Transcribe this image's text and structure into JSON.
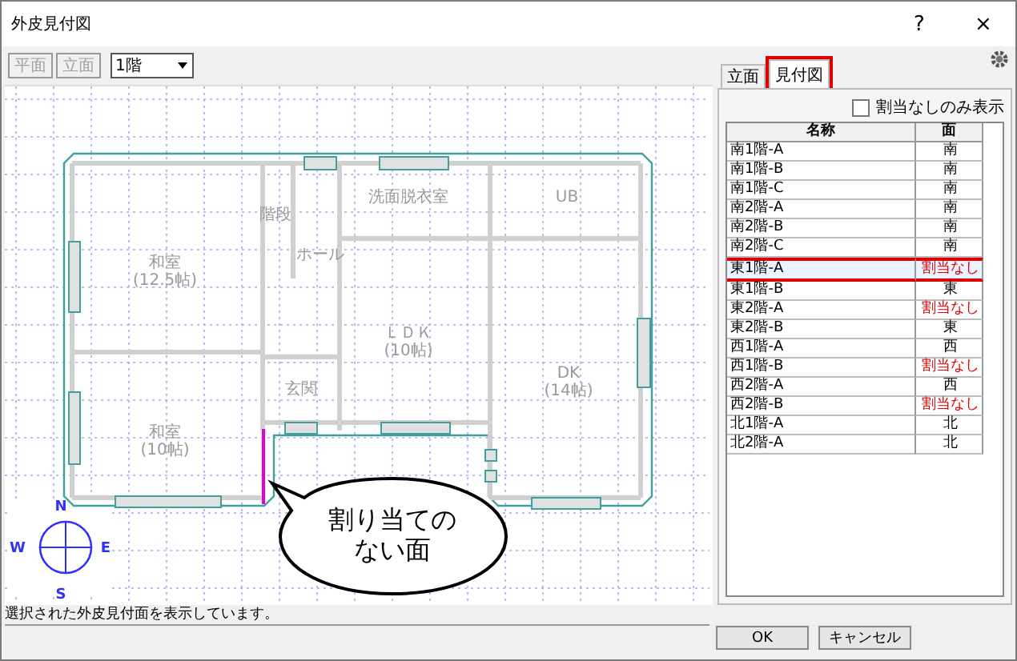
{
  "window": {
    "title": "外皮見付図",
    "help": "?",
    "close": "×"
  },
  "toolbar": {
    "buttons": [
      {
        "label": "平面",
        "disabled": true
      },
      {
        "label": "立面",
        "disabled": true
      }
    ],
    "floor_select": {
      "value": "1階"
    }
  },
  "plan": {
    "rooms": [
      {
        "name": "和室",
        "area": "(12.5帖)"
      },
      {
        "name": "階段"
      },
      {
        "name": "ホール"
      },
      {
        "name": "洗面脱衣室"
      },
      {
        "name": "UB"
      },
      {
        "name": "ＬＤＫ",
        "area": "(10帖)"
      },
      {
        "name": "DK",
        "area": "(14帖)"
      },
      {
        "name": "玄関"
      },
      {
        "name": "和室",
        "area": "(10帖)"
      }
    ],
    "compass": {
      "n": "N",
      "w": "W",
      "e": "E",
      "s": "S"
    },
    "callout": {
      "lines": [
        "割り当ての",
        "ない面"
      ]
    }
  },
  "tabs": [
    {
      "label": "立面",
      "selected": false
    },
    {
      "label": "見付図",
      "selected": true
    }
  ],
  "filter": {
    "label": "割当なしのみ表示",
    "checked": false
  },
  "table": {
    "columns": [
      "名称",
      "面"
    ],
    "rows": [
      {
        "name": "南1階-A",
        "face": "南",
        "unassigned": false,
        "selected": false
      },
      {
        "name": "南1階-B",
        "face": "南",
        "unassigned": false,
        "selected": false
      },
      {
        "name": "南1階-C",
        "face": "南",
        "unassigned": false,
        "selected": false
      },
      {
        "name": "南2階-A",
        "face": "南",
        "unassigned": false,
        "selected": false
      },
      {
        "name": "南2階-B",
        "face": "南",
        "unassigned": false,
        "selected": false
      },
      {
        "name": "南2階-C",
        "face": "南",
        "unassigned": false,
        "selected": false
      },
      {
        "name": "東1階-A",
        "face": "割当なし",
        "unassigned": true,
        "selected": true
      },
      {
        "name": "東1階-B",
        "face": "東",
        "unassigned": false,
        "selected": false
      },
      {
        "name": "東2階-A",
        "face": "割当なし",
        "unassigned": true,
        "selected": false
      },
      {
        "name": "東2階-B",
        "face": "東",
        "unassigned": false,
        "selected": false
      },
      {
        "name": "西1階-A",
        "face": "西",
        "unassigned": false,
        "selected": false
      },
      {
        "name": "西1階-B",
        "face": "割当なし",
        "unassigned": true,
        "selected": false
      },
      {
        "name": "西2階-A",
        "face": "西",
        "unassigned": false,
        "selected": false
      },
      {
        "name": "西2階-B",
        "face": "割当なし",
        "unassigned": true,
        "selected": false
      },
      {
        "name": "北1階-A",
        "face": "北",
        "unassigned": false,
        "selected": false
      },
      {
        "name": "北2階-A",
        "face": "北",
        "unassigned": false,
        "selected": false
      }
    ]
  },
  "status_bar": "選択された外皮見付面を表示しています。",
  "buttons": [
    "OK",
    "キャンセル"
  ]
}
